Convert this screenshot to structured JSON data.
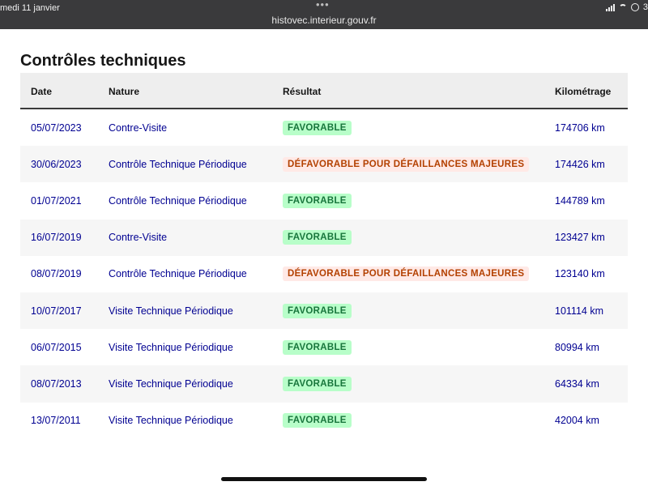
{
  "status_bar": {
    "date": "medi 11 janvier",
    "url": "histovec.interieur.gouv.fr",
    "battery": "3"
  },
  "page": {
    "title": "Contrôles techniques"
  },
  "table": {
    "headers": {
      "date": "Date",
      "nature": "Nature",
      "resultat": "Résultat",
      "kilometrage": "Kilométrage"
    },
    "rows": [
      {
        "date": "05/07/2023",
        "nature": "Contre-Visite",
        "resultat": "FAVORABLE",
        "status": "fav",
        "km": "174706 km"
      },
      {
        "date": "30/06/2023",
        "nature": "Contrôle Technique Périodique",
        "resultat": "DÉFAVORABLE POUR DÉFAILLANCES MAJEURES",
        "status": "defav",
        "km": "174426 km"
      },
      {
        "date": "01/07/2021",
        "nature": "Contrôle Technique Périodique",
        "resultat": "FAVORABLE",
        "status": "fav",
        "km": "144789 km"
      },
      {
        "date": "16/07/2019",
        "nature": "Contre-Visite",
        "resultat": "FAVORABLE",
        "status": "fav",
        "km": "123427 km"
      },
      {
        "date": "08/07/2019",
        "nature": "Contrôle Technique Périodique",
        "resultat": "DÉFAVORABLE POUR DÉFAILLANCES MAJEURES",
        "status": "defav",
        "km": "123140 km"
      },
      {
        "date": "10/07/2017",
        "nature": "Visite Technique Périodique",
        "resultat": "FAVORABLE",
        "status": "fav",
        "km": "101114 km"
      },
      {
        "date": "06/07/2015",
        "nature": "Visite Technique Périodique",
        "resultat": "FAVORABLE",
        "status": "fav",
        "km": "80994 km"
      },
      {
        "date": "08/07/2013",
        "nature": "Visite Technique Périodique",
        "resultat": "FAVORABLE",
        "status": "fav",
        "km": "64334 km"
      },
      {
        "date": "13/07/2011",
        "nature": "Visite Technique Périodique",
        "resultat": "FAVORABLE",
        "status": "fav",
        "km": "42004 km"
      }
    ]
  },
  "colors": {
    "link_blue": "#000091",
    "favorable_bg": "#b8fec9",
    "favorable_text": "#18753c",
    "defavorable_bg": "#ffe9e6",
    "defavorable_text": "#b34000"
  }
}
